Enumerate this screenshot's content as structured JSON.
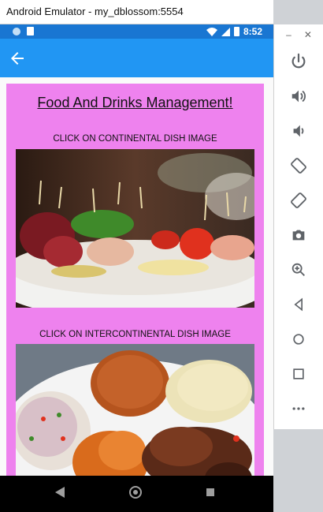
{
  "window": {
    "title": "Android Emulator - my_dblossom:5554"
  },
  "status_bar": {
    "time": "8:52"
  },
  "app": {
    "heading": "Food And Drinks Management!",
    "continental_label": "CLICK ON CONTINENTAL DISH IMAGE",
    "intercontinental_label": "CLICK ON INTERCONTINENTAL DISH IMAGE"
  },
  "emulator_controls": {
    "minimize_glyph": "–",
    "close_glyph": "✕",
    "tools": [
      "power-icon",
      "volume-up-icon",
      "volume-down-icon",
      "rotate-left-icon",
      "rotate-right-icon",
      "camera-icon",
      "zoom-icon",
      "back-icon",
      "home-icon",
      "overview-icon",
      "more-icon"
    ]
  },
  "colors": {
    "appbar": "#2196f3",
    "statusbar": "#1976d2",
    "card": "#ee82ee"
  }
}
